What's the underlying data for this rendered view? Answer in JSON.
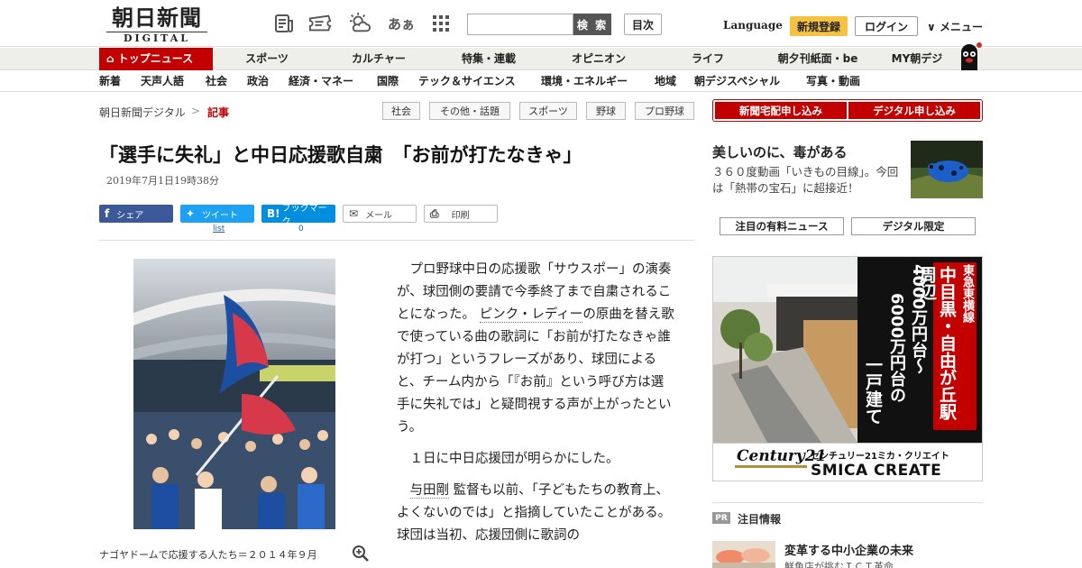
{
  "header": {
    "logo_jp": "朝日新聞",
    "logo_en": "DIGITAL",
    "kana_icon": "あぁ",
    "search_placeholder": "",
    "search_button": "検 索",
    "toc_button": "目次",
    "language": "Language",
    "register": "新規登録",
    "login": "ログイン",
    "menu": "メニュー"
  },
  "nav_primary": {
    "top_news": "トップニュース",
    "items": [
      "スポーツ",
      "カルチャー",
      "特集・連載",
      "オピニオン",
      "ライフ",
      "朝夕刊紙面・be",
      "MY朝デジ"
    ]
  },
  "nav_secondary": {
    "items": [
      "新着",
      "天声人語",
      "社会",
      "政治",
      "経済・マネー",
      "国際",
      "テック＆サイエンス",
      "環境・エネルギー",
      "地域",
      "朝デジスペシャル",
      "写真・動画"
    ]
  },
  "breadcrumb": {
    "home": "朝日新聞デジタル",
    "sep": ">",
    "current": "記事"
  },
  "tags": [
    "社会",
    "その他・話題",
    "スポーツ",
    "野球",
    "プロ野球"
  ],
  "article": {
    "title": "「選手に失礼」と中日応援歌自粛　「お前が打たなきゃ」",
    "date": "2019年7月1日19時38分",
    "share": {
      "facebook": "シェア",
      "twitter": "ツイート",
      "twitter_sub": "list",
      "hatena": "ブックマーク",
      "hatena_count": "0",
      "mail": "メール",
      "print": "印刷"
    },
    "photo_caption": "ナゴヤドームで応援する人たち＝２０１４年９月",
    "p1_a": "プロ野球中日の応援歌「サウスポー」の演奏が、球団側の要請で今季終了まで自粛されることになった。",
    "p1_link": "ピンク・レディー",
    "p1_b": "の原曲を替え歌で使っている曲の歌詞に「お前が打たなきゃ誰が打つ」というフレーズがあり、球団によると、チーム内から「『お前』という呼び方は選手に失礼では」と疑問視する声が上がったという。",
    "p2": "１日に中日応援団が明らかにした。",
    "p3_link": "与田剛",
    "p3_b": "監督も以前、「子どもたちの教育上、よくないのでは」と指摘していたことがある。球団は当初、応援団側に歌詞の"
  },
  "sidebar": {
    "subscribe_paper": "新聞宅配申し込み",
    "subscribe_digital": "デジタル申し込み",
    "promo_title": "美しいのに、毒がある",
    "promo_text": "３６０度動画「いきもの目線」。今回は「熱帯の宝石」に超接近！",
    "paid_news": "注目の有料ニュース",
    "digital_only": "デジタル限定",
    "ad": {
      "line_label": "東急東横線",
      "area": "中目黒・自由が丘駅周辺",
      "price1": "4000万円台～",
      "price2": "6000万円台の",
      "type": "一戸建て",
      "brand_jp": "センチュリー21ミカ・クリエイト",
      "brand_en": "SMICA CREATE",
      "logo": "Century21"
    },
    "pr_badge": "PR",
    "pr_label": "注目情報",
    "pr_headline": "変革する中小企業の未来",
    "pr_sub": "鮮魚店が挑むＩＣＴ革命"
  },
  "colors": {
    "brand_red": "#c20000",
    "register_yellow": "#f5c242",
    "facebook": "#3b5998",
    "twitter": "#1da1f2",
    "hatena": "#008fde"
  }
}
